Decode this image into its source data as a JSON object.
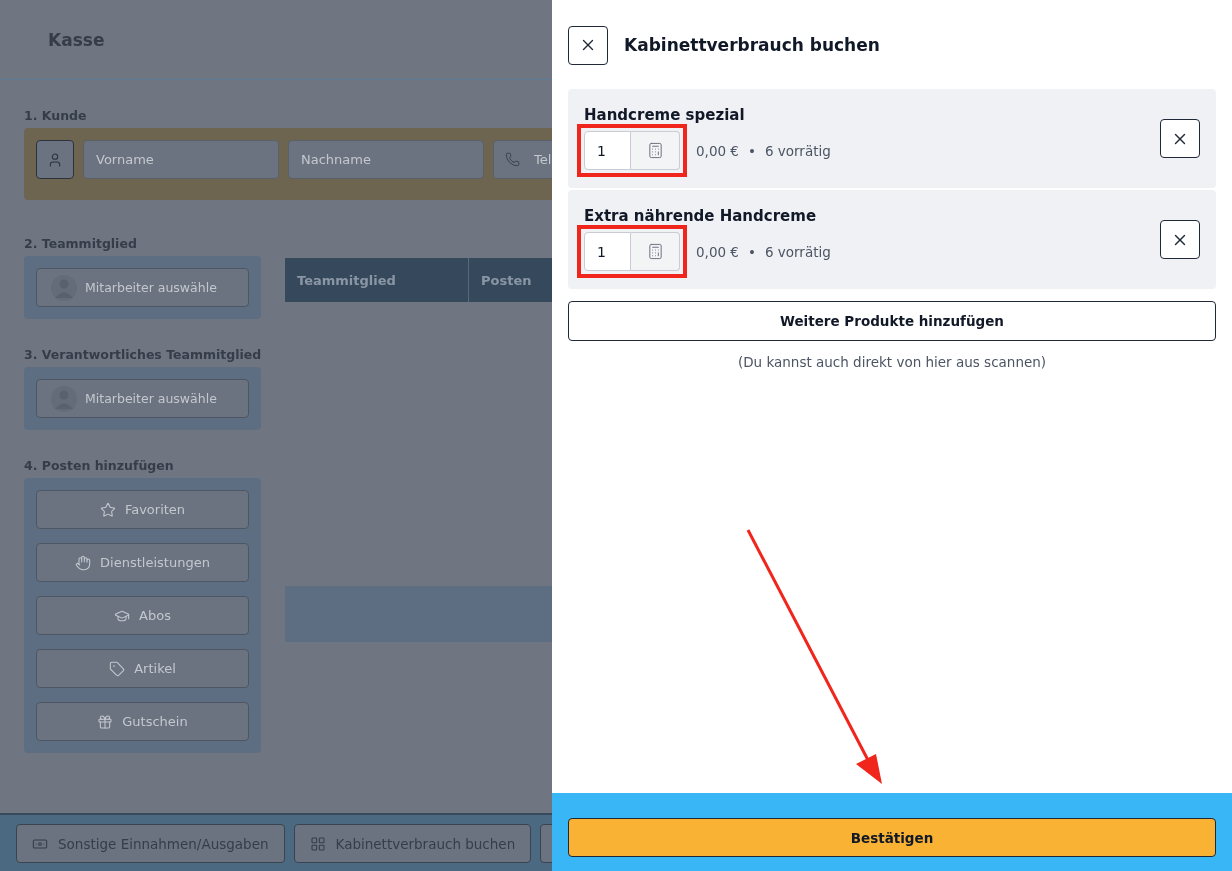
{
  "page": {
    "title": "Kasse",
    "customer": {
      "heading": "1. Kunde",
      "fields": [
        {
          "placeholder": "Vorname",
          "kind": "text"
        },
        {
          "placeholder": "Nachname",
          "kind": "text"
        },
        {
          "placeholder": "Tel",
          "kind": "phone"
        }
      ]
    },
    "team_member": {
      "heading": "2. Teammitglied",
      "picker": "Mitarbeiter auswähle"
    },
    "responsible": {
      "heading": "3. Verantwortliches Teammitglied",
      "picker": "Mitarbeiter auswähle"
    },
    "add_items": {
      "heading": "4. Posten hinzufügen",
      "buttons": [
        {
          "label": "Favoriten",
          "kind": "star"
        },
        {
          "label": "Dienstleistungen",
          "kind": "hand"
        },
        {
          "label": "Abos",
          "kind": "cap"
        },
        {
          "label": "Artikel",
          "kind": "tag"
        },
        {
          "label": "Gutschein",
          "kind": "gift"
        }
      ]
    },
    "table": {
      "columns": [
        "Teammitglied",
        "Posten"
      ]
    },
    "bottom_bar": {
      "buttons": [
        {
          "label": "Sonstige Einnahmen/Ausgaben",
          "kind": "cash"
        },
        {
          "label": "Kabinettverbrauch buchen",
          "kind": "grid"
        }
      ]
    }
  },
  "drawer": {
    "title": "Kabinettverbrauch buchen",
    "items": [
      {
        "name": "Handcreme spezial",
        "quantity": "1",
        "price": "0,00 €",
        "separator": "•",
        "stock": "6 vorrätig",
        "highlighted": true
      },
      {
        "name": "Extra nährende Handcreme",
        "quantity": "1",
        "price": "0,00 €",
        "separator": "•",
        "stock": "6 vorrätig",
        "highlighted": true
      }
    ],
    "add_button": "Weitere Produkte hinzufügen",
    "hint": "(Du kannst auch direkt von hier aus scannen)",
    "confirm_button": "Bestätigen"
  }
}
